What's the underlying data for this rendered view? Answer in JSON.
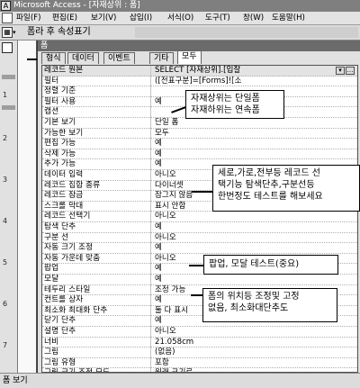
{
  "titlebar": {
    "icon": "access-icon",
    "title": "Microsoft Access - [자재상위 : 폼]"
  },
  "menubar": {
    "items": [
      "파일(F)",
      "편집(E)",
      "보기(V)",
      "삽입(I)",
      "서식(O)",
      "도구(T)",
      "창(W)",
      "도움말(H)"
    ]
  },
  "toolbar": {
    "caption": "폼라 후 속성표기"
  },
  "left_ruler": [
    "1",
    "2",
    "3",
    "4",
    "5",
    "6",
    "7"
  ],
  "sheet": {
    "title": "폼",
    "tabs": [
      "형식",
      "데이터",
      "이벤트",
      "기타",
      "모두"
    ],
    "active_tab": "모두",
    "rows": [
      {
        "name": "레코드 원본",
        "value": "SELECT [자재상위].[입찰"
      },
      {
        "name": "필터",
        "value": "([전표구분]=[Forms]![소"
      },
      {
        "name": "정렬 기준",
        "value": ""
      },
      {
        "name": "필터 사용",
        "value": "예"
      },
      {
        "name": "캡션",
        "value": ""
      },
      {
        "name": "기본 보기",
        "value": "단일 폼"
      },
      {
        "name": "가능한 보기",
        "value": "모두"
      },
      {
        "name": "편집 가능",
        "value": "예"
      },
      {
        "name": "삭제 가능",
        "value": "예"
      },
      {
        "name": "추가 가능",
        "value": "예"
      },
      {
        "name": "데이터 입력",
        "value": "아니오"
      },
      {
        "name": "레코드 집합 종류",
        "value": "다이너셋"
      },
      {
        "name": "레코드 잠금",
        "value": "잠그지 않음"
      },
      {
        "name": "스크롤 막대",
        "value": "표시 안함"
      },
      {
        "name": "레코드 선택기",
        "value": "아니오"
      },
      {
        "name": "탐색 단추",
        "value": "예"
      },
      {
        "name": "구분 선",
        "value": "아니오"
      },
      {
        "name": "자동 크기 조정",
        "value": "예"
      },
      {
        "name": "자동 가운데 맞춤",
        "value": "아니오"
      },
      {
        "name": "팝업",
        "value": "예"
      },
      {
        "name": "모달",
        "value": "예"
      },
      {
        "name": "테두리 스타일",
        "value": "조정 가능"
      },
      {
        "name": "컨트롤 상자",
        "value": "예"
      },
      {
        "name": "최소화 최대화 단추",
        "value": "둘 다 표시"
      },
      {
        "name": "닫기 단추",
        "value": "예"
      },
      {
        "name": "설명 단추",
        "value": "아니오"
      },
      {
        "name": "너비",
        "value": "21.058cm"
      },
      {
        "name": "그림",
        "value": "(없음)"
      },
      {
        "name": "그림 유형",
        "value": "포함"
      },
      {
        "name": "그림 크기 조정 모드",
        "value": "원래 크기로"
      },
      {
        "name": "그림 맞춤",
        "value": "가운데"
      }
    ]
  },
  "notes": {
    "note1": [
      "자재상위는 단일폼",
      "자재하위는 연속폼"
    ],
    "note2": [
      "세로,가로,전부등 레코드 선",
      "택기능 탐색단추,구분선등",
      "한번정도 테스트를 해보세요"
    ],
    "note3": [
      "팝업, 모달 테스트(중요)"
    ],
    "note4": [
      "폼의 위치등 조정및 고정",
      "없음, 최소화대단추도"
    ]
  },
  "status": {
    "text": "폼 보기"
  }
}
